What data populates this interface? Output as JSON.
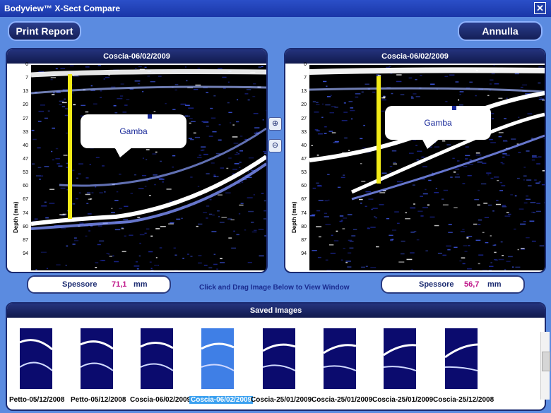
{
  "window": {
    "title": "Bodyview™ X-Sect Compare",
    "close_icon": "close-icon"
  },
  "toolbar": {
    "print_label": "Print Report",
    "cancel_label": "Annulla"
  },
  "left_panel": {
    "title": "Coscia-06/02/2009",
    "axis_label": "Depth (mm)",
    "ticks": [
      "0",
      "7",
      "13",
      "20",
      "27",
      "33",
      "40",
      "47",
      "53",
      "60",
      "67",
      "74",
      "80",
      "87",
      "94"
    ],
    "bubble": "Gamba",
    "thickness_label": "Spessore",
    "thickness_value": "71,1",
    "thickness_unit": "mm"
  },
  "right_panel": {
    "title": "Coscia-06/02/2009",
    "axis_label": "Depth (mm)",
    "ticks": [
      "0",
      "7",
      "13",
      "20",
      "27",
      "33",
      "40",
      "47",
      "53",
      "60",
      "67",
      "74",
      "80",
      "87",
      "94"
    ],
    "bubble": "Gamba",
    "thickness_label": "Spessore",
    "thickness_value": "56,7",
    "thickness_unit": "mm"
  },
  "hint": "Click and Drag Image Below to  View Window",
  "zoom": {
    "in_icon": "zoom-in-icon",
    "out_icon": "zoom-out-icon"
  },
  "saved": {
    "title": "Saved Images",
    "items": [
      {
        "label": "Petto-05/12/2008",
        "selected": false
      },
      {
        "label": "Petto-05/12/2008",
        "selected": false
      },
      {
        "label": "Coscia-06/02/2009",
        "selected": false
      },
      {
        "label": "Coscia-06/02/2009",
        "selected": true
      },
      {
        "label": "Coscia-25/01/2009",
        "selected": false
      },
      {
        "label": "Coscia-25/01/2009",
        "selected": false
      },
      {
        "label": "Coscia-25/01/2009",
        "selected": false
      },
      {
        "label": "Coscia-25/12/2008",
        "selected": false
      }
    ]
  },
  "colors": {
    "accent": "#5b8be0",
    "selected": "#39a0f0",
    "value": "#c0188a",
    "measure": "#f1ea16"
  }
}
